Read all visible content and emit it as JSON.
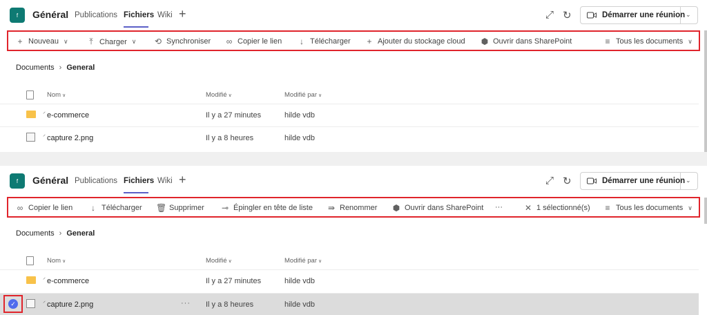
{
  "top": {
    "team_icon": "f",
    "team_name": "Général",
    "tabs": [
      "Publications",
      "Fichiers",
      "Wiki"
    ],
    "meet_button": "Démarrer une réunion",
    "toolbar": [
      {
        "label": "Nouveau",
        "icon": "plus-icon"
      },
      {
        "label": "Charger",
        "icon": "upload-icon"
      },
      {
        "label": "Synchroniser",
        "icon": "sync-icon"
      },
      {
        "label": "Copier le lien",
        "icon": "link-icon"
      },
      {
        "label": "Télécharger",
        "icon": "download-icon"
      },
      {
        "label": "Ajouter du stockage cloud",
        "icon": "plus-icon"
      },
      {
        "label": "Ouvrir dans SharePoint",
        "icon": "sharepoint-icon"
      },
      {
        "label": "Tous les documents",
        "icon": "list-icon"
      }
    ],
    "breadcrumb": {
      "root": "Documents",
      "current": "General"
    },
    "columns": [
      "Nom",
      "Modifié",
      "Modifié par"
    ],
    "rows": [
      {
        "name": "e-commerce",
        "modified": "Il y a 27 minutes",
        "by": "hilde vdb",
        "type": "folder"
      },
      {
        "name": "capture 2.png",
        "modified": "Il y a 8 heures",
        "by": "hilde vdb",
        "type": "image"
      }
    ]
  },
  "bottom": {
    "team_icon": "f",
    "team_name": "Général",
    "tabs": [
      "Publications",
      "Fichiers",
      "Wiki"
    ],
    "meet_button": "Démarrer une réunion",
    "toolbar": [
      {
        "label": "Copier le lien",
        "icon": "link-icon"
      },
      {
        "label": "Télécharger",
        "icon": "download-icon"
      },
      {
        "label": "Supprimer",
        "icon": "trash-icon"
      },
      {
        "label": "Épingler en tête de liste",
        "icon": "pin-icon"
      },
      {
        "label": "Renommer",
        "icon": "rename-icon"
      },
      {
        "label": "Ouvrir dans SharePoint",
        "icon": "sharepoint-icon"
      },
      {
        "label": "···",
        "icon": "more-icon"
      },
      {
        "label": "1 sélectionné(s)",
        "icon": "close-icon"
      },
      {
        "label": "Tous les documents",
        "icon": "list-icon"
      }
    ],
    "breadcrumb": {
      "root": "Documents",
      "current": "General"
    },
    "columns": [
      "Nom",
      "Modifié",
      "Modifié par"
    ],
    "rows": [
      {
        "name": "e-commerce",
        "modified": "Il y a 27 minutes",
        "by": "hilde vdb",
        "type": "folder"
      },
      {
        "name": "capture 2.png",
        "modified": "Il y a 8 heures",
        "by": "hilde vdb",
        "type": "image",
        "selected": true,
        "more": "···"
      }
    ]
  },
  "colors": {
    "accent": "#5b5fc7",
    "highlight_box": "#e0242b",
    "team_icon": "#0e7a73",
    "check": "#4f6bed"
  }
}
